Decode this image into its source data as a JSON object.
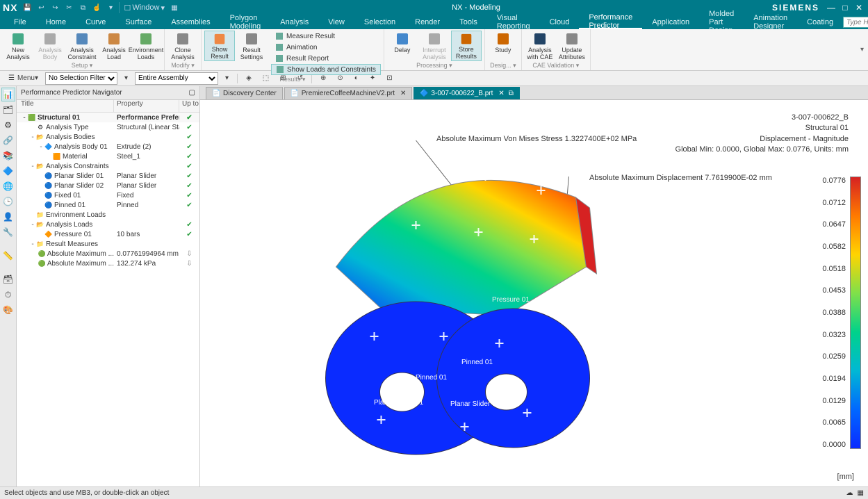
{
  "app": {
    "logo": "NX",
    "title": "NX - Modeling",
    "brand": "SIEMENS",
    "window_menu": "Window"
  },
  "menu": [
    "File",
    "Home",
    "Curve",
    "Surface",
    "Assemblies",
    "Polygon Modeling",
    "Analysis",
    "View",
    "Selection",
    "Render",
    "Tools",
    "Visual Reporting",
    "Cloud",
    "Performance Predictor",
    "Application",
    "Molded Part Design",
    "Animation Designer",
    "Coating"
  ],
  "menu_active": "Performance Predictor",
  "search_placeholder": "Type Here to Search",
  "ribbon": {
    "groups": [
      {
        "label": "Setup",
        "buttons": [
          {
            "id": "new-analysis",
            "l1": "New",
            "l2": "Analysis"
          },
          {
            "id": "analysis-body",
            "l1": "Analysis",
            "l2": "Body",
            "d": true
          },
          {
            "id": "analysis-constraint",
            "l1": "Analysis",
            "l2": "Constraint"
          },
          {
            "id": "analysis-load",
            "l1": "Analysis",
            "l2": "Load"
          },
          {
            "id": "environment-loads",
            "l1": "Environment",
            "l2": "Loads"
          }
        ]
      },
      {
        "label": "Modify",
        "buttons": [
          {
            "id": "clone-analysis",
            "l1": "Clone",
            "l2": "Analysis"
          }
        ]
      },
      {
        "label": "Results",
        "buttons": [
          {
            "id": "show-result",
            "l1": "Show",
            "l2": "Result",
            "sel": true
          },
          {
            "id": "result-settings",
            "l1": "Result",
            "l2": "Settings"
          }
        ],
        "side": [
          {
            "id": "measure-result",
            "label": "Measure Result"
          },
          {
            "id": "animation",
            "label": "Animation"
          },
          {
            "id": "result-report",
            "label": "Result Report"
          },
          {
            "id": "show-loads-constraints",
            "label": "Show Loads and Constraints",
            "sel": true
          }
        ]
      },
      {
        "label": "Processing",
        "buttons": [
          {
            "id": "delay",
            "l1": "Delay",
            "l2": ""
          },
          {
            "id": "interrupt-analysis",
            "l1": "Interrupt",
            "l2": "Analysis",
            "d": true
          },
          {
            "id": "store-results",
            "l1": "Store",
            "l2": "Results",
            "sel": true
          }
        ]
      },
      {
        "label": "Desig...",
        "buttons": [
          {
            "id": "study",
            "l1": "Study",
            "l2": ""
          }
        ]
      },
      {
        "label": "CAE Validation",
        "buttons": [
          {
            "id": "analysis-with-cae",
            "l1": "Analysis",
            "l2": "with CAE"
          },
          {
            "id": "update-attributes",
            "l1": "Update",
            "l2": "Attributes"
          }
        ]
      }
    ]
  },
  "toolbar2": {
    "menu": "Menu",
    "filter": "No Selection Filter",
    "scope": "Entire Assembly"
  },
  "nav": {
    "title": "Performance Predictor Navigator",
    "cols": [
      "Title",
      "Property",
      "Up to"
    ],
    "rows": [
      {
        "d": 0,
        "e": "-",
        "t": "Structural 01",
        "p": "Performance Preferred",
        "s": "ok",
        "bold": true,
        "ic": "box-g"
      },
      {
        "d": 1,
        "e": "",
        "t": "Analysis Type",
        "p": "Structural (Linear Statics)",
        "s": "ok",
        "ic": "gear"
      },
      {
        "d": 1,
        "e": "-",
        "t": "Analysis Bodies",
        "p": "",
        "s": "ok",
        "ic": "fold-g"
      },
      {
        "d": 2,
        "e": "-",
        "t": "Analysis Body 01",
        "p": "Extrude (2)",
        "s": "ok",
        "ic": "body"
      },
      {
        "d": 3,
        "e": "",
        "t": "Material",
        "p": "Steel_1",
        "s": "ok",
        "ic": "mat"
      },
      {
        "d": 1,
        "e": "-",
        "t": "Analysis Constraints",
        "p": "",
        "s": "ok",
        "ic": "fold-g"
      },
      {
        "d": 2,
        "e": "",
        "t": "Planar Slider 01",
        "p": "Planar Slider",
        "s": "ok",
        "ic": "con"
      },
      {
        "d": 2,
        "e": "",
        "t": "Planar Slider 02",
        "p": "Planar Slider",
        "s": "ok",
        "ic": "con"
      },
      {
        "d": 2,
        "e": "",
        "t": "Fixed 01",
        "p": "Fixed",
        "s": "ok",
        "ic": "con"
      },
      {
        "d": 2,
        "e": "",
        "t": "Pinned 01",
        "p": "Pinned",
        "s": "ok",
        "ic": "con"
      },
      {
        "d": 1,
        "e": "",
        "t": "Environment Loads",
        "p": "",
        "s": "",
        "ic": "fold"
      },
      {
        "d": 1,
        "e": "-",
        "t": "Analysis Loads",
        "p": "",
        "s": "ok",
        "ic": "fold-g"
      },
      {
        "d": 2,
        "e": "",
        "t": "Pressure 01",
        "p": "10 bars",
        "s": "ok",
        "ic": "load"
      },
      {
        "d": 1,
        "e": "-",
        "t": "Result Measures",
        "p": "",
        "s": "",
        "ic": "fold"
      },
      {
        "d": 2,
        "e": "",
        "t": "Absolute Maximum ...",
        "p": "0.07761994964 mm",
        "s": "dn",
        "ic": "res"
      },
      {
        "d": 2,
        "e": "",
        "t": "Absolute Maximum ...",
        "p": "132.274 kPa",
        "s": "dn",
        "ic": "res"
      }
    ]
  },
  "tabs": [
    {
      "label": "Discovery Center",
      "active": false,
      "closable": false
    },
    {
      "label": "PremiereCoffeeMachineV2.prt",
      "active": false,
      "closable": true
    },
    {
      "label": "3-007-000622_B.prt",
      "active": true,
      "closable": true
    }
  ],
  "info": {
    "line1": "3-007-000622_B",
    "line2": "Structural 01",
    "line3": "Displacement - Magnitude",
    "line4": "Global Min: 0.0000, Global Max: 0.0776, Units: mm"
  },
  "ann": {
    "stress": "Absolute Maximum Von Mises Stress 1.3227400E+02 MPa",
    "disp": "Absolute Maximum Displacement 7.7619900E-02 mm"
  },
  "legend": {
    "unit": "[mm]",
    "ticks": [
      "0.0776",
      "0.0712",
      "0.0647",
      "0.0582",
      "0.0518",
      "0.0453",
      "0.0388",
      "0.0323",
      "0.0259",
      "0.0194",
      "0.0129",
      "0.0065",
      "0.0000"
    ]
  },
  "model_labels": {
    "pinned": "Pinned 01",
    "pinned2": "Pinned 01",
    "ps1": "Planar Slider 01",
    "ps2": "Planar Slider 02",
    "pressure": "Pressure 01"
  },
  "status": {
    "msg": "Select objects and use MB3, or double-click an object"
  }
}
